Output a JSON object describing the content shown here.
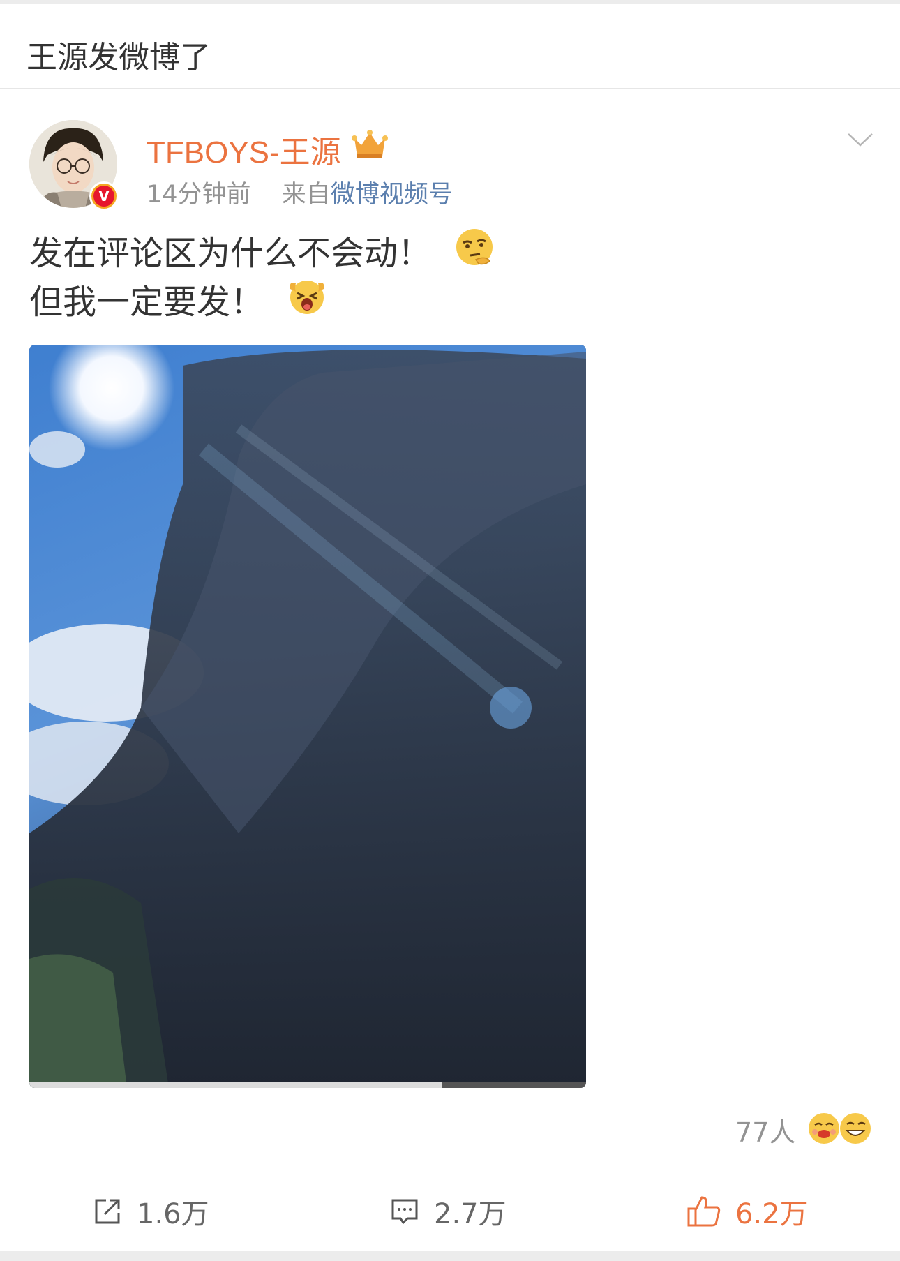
{
  "header": {
    "title": "王源发微博了"
  },
  "post": {
    "author": "TFBOYS-王源",
    "time": "14分钟前",
    "source_prefix": "来自",
    "source": "微博视频号",
    "text_lines": [
      "发在评论区为什么不会动！",
      "但我一定要发！"
    ],
    "video_progress": 0.26
  },
  "reactions": {
    "count_label": "77人"
  },
  "actions": {
    "share": "1.6万",
    "comment": "2.7万",
    "like": "6.2万"
  },
  "colors": {
    "username": "#eb7340",
    "source_link": "#5b7fae",
    "like_active": "#eb7340"
  }
}
